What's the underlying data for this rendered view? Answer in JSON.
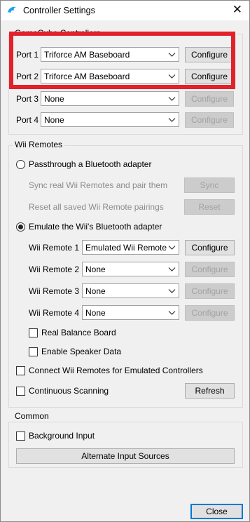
{
  "window": {
    "title": "Controller Settings",
    "close_glyph": "✕",
    "icon": "dolphin-icon"
  },
  "gamecube": {
    "title": "GameCube Controllers",
    "ports": [
      {
        "label": "Port 1",
        "value": "Triforce AM Baseboard",
        "button": "Configure",
        "button_enabled": true
      },
      {
        "label": "Port 2",
        "value": "Triforce AM Baseboard",
        "button": "Configure",
        "button_enabled": true
      },
      {
        "label": "Port 3",
        "value": "None",
        "button": "Configure",
        "button_enabled": false
      },
      {
        "label": "Port 4",
        "value": "None",
        "button": "Configure",
        "button_enabled": false
      }
    ]
  },
  "wii": {
    "title": "Wii Remotes",
    "passthrough_label": "Passthrough a Bluetooth adapter",
    "passthrough_selected": false,
    "sync_label": "Sync real Wii Remotes and pair them",
    "sync_button": "Sync",
    "reset_label": "Reset all saved Wii Remote pairings",
    "reset_button": "Reset",
    "emulate_label": "Emulate the Wii's Bluetooth adapter",
    "emulate_selected": true,
    "remotes": [
      {
        "label": "Wii Remote 1",
        "value": "Emulated Wii Remote",
        "button": "Configure",
        "button_enabled": true
      },
      {
        "label": "Wii Remote 2",
        "value": "None",
        "button": "Configure",
        "button_enabled": false
      },
      {
        "label": "Wii Remote 3",
        "value": "None",
        "button": "Configure",
        "button_enabled": false
      },
      {
        "label": "Wii Remote 4",
        "value": "None",
        "button": "Configure",
        "button_enabled": false
      }
    ],
    "balance_board_label": "Real Balance Board",
    "balance_board_checked": false,
    "speaker_label": "Enable Speaker Data",
    "speaker_checked": false,
    "connect_label": "Connect Wii Remotes for Emulated Controllers",
    "connect_checked": false,
    "scanning_label": "Continuous Scanning",
    "scanning_checked": false,
    "refresh_button": "Refresh"
  },
  "common": {
    "title": "Common",
    "background_label": "Background Input",
    "background_checked": false,
    "alternate_button": "Alternate Input Sources"
  },
  "footer": {
    "close_button": "Close"
  },
  "colors": {
    "highlight": "#e3212b",
    "accent": "#0078d7",
    "app_icon": "#1aa3e8"
  }
}
